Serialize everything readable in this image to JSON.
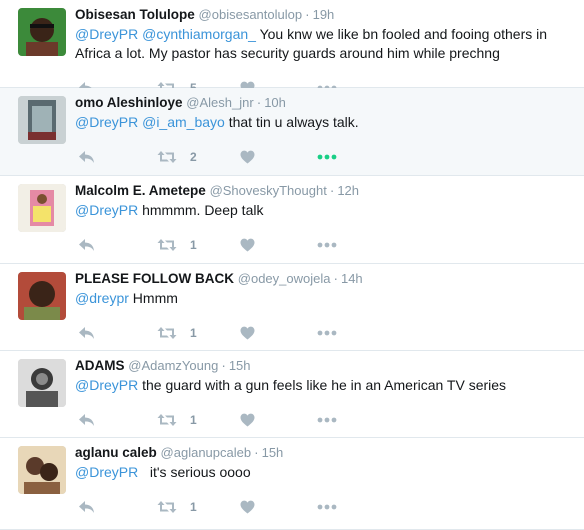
{
  "tweets": [
    {
      "fullname": "Obisesan Tolulope",
      "username": "@obisesantolulop",
      "time": "19h",
      "text_parts": [
        {
          "text": "@DreyPR",
          "mention": true
        },
        {
          "text": " ",
          "mention": false
        },
        {
          "text": "@cynthiamorgan_",
          "mention": true
        },
        {
          "text": " You knw we like bn fooled and fooing others in Africa a lot. My pastor has security guards around him while prechng",
          "mention": false
        }
      ],
      "retweets": "5",
      "highlighted": false
    },
    {
      "fullname": "omo Aleshinloye",
      "username": "@Alesh_jnr",
      "time": "10h",
      "text_parts": [
        {
          "text": "@DreyPR",
          "mention": true
        },
        {
          "text": " ",
          "mention": false
        },
        {
          "text": "@i_am_bayo",
          "mention": true
        },
        {
          "text": " that tin u always talk.",
          "mention": false
        }
      ],
      "retweets": "2",
      "highlighted": true
    },
    {
      "fullname": "Malcolm E. Ametepe",
      "username": "@ShoveskyThought",
      "time": "12h",
      "text_parts": [
        {
          "text": "@DreyPR",
          "mention": true
        },
        {
          "text": " hmmmm. Deep talk",
          "mention": false
        }
      ],
      "retweets": "1",
      "highlighted": false
    },
    {
      "fullname": "PLEASE FOLLOW BACK",
      "username": "@odey_owojela",
      "time": "14h",
      "text_parts": [
        {
          "text": "@dreypr",
          "mention": true
        },
        {
          "text": " Hmmm",
          "mention": false
        }
      ],
      "retweets": "1",
      "highlighted": false
    },
    {
      "fullname": "ADAMS",
      "username": "@AdamzYoung",
      "time": "15h",
      "text_parts": [
        {
          "text": "@DreyPR",
          "mention": true
        },
        {
          "text": " the guard with a gun feels like he in an American TV series",
          "mention": false
        }
      ],
      "retweets": "1",
      "highlighted": false
    },
    {
      "fullname": "aglanu caleb",
      "username": "@aglanupcaleb",
      "time": "15h",
      "text_parts": [
        {
          "text": "@DreyPR",
          "mention": true
        },
        {
          "text": "   it's serious oooo",
          "mention": false
        }
      ],
      "retweets": "1",
      "highlighted": false
    }
  ],
  "icons": {
    "reply": "reply-icon",
    "retweet": "retweet-icon",
    "like": "heart-icon",
    "more": "more-icon"
  },
  "colors": {
    "mention": "#3b94d9",
    "icon": "#aab8c2",
    "more_active": "#19cf86",
    "highlight_bg": "#f5f8fa"
  }
}
